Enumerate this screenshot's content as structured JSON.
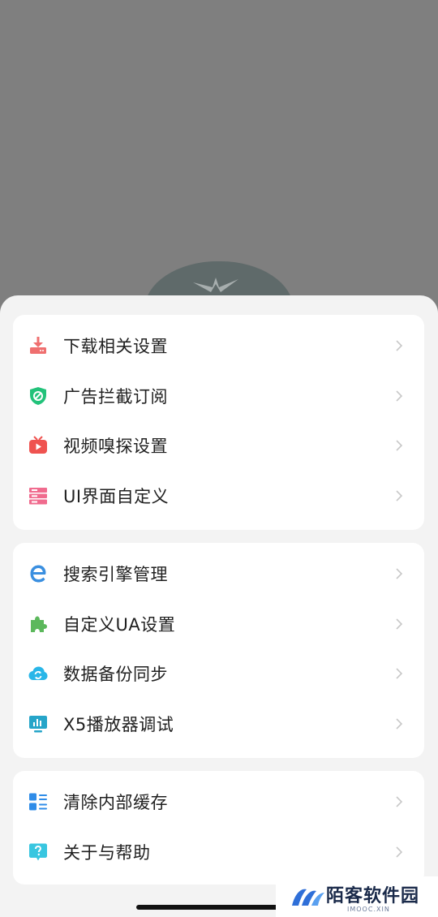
{
  "groups": [
    {
      "items": [
        {
          "label": "下载相关设置",
          "icon": "download-icon",
          "color": "#ef6f6f"
        },
        {
          "label": "广告拦截订阅",
          "icon": "ad-block-shield-icon",
          "color": "#22c27a"
        },
        {
          "label": "视频嗅探设置",
          "icon": "video-tv-icon",
          "color": "#ef5350"
        },
        {
          "label": "UI界面自定义",
          "icon": "ui-layout-icon",
          "color": "#f06b8e"
        }
      ]
    },
    {
      "items": [
        {
          "label": "搜索引擎管理",
          "icon": "search-engine-e-icon",
          "color": "#3a8fe0"
        },
        {
          "label": "自定义UA设置",
          "icon": "puzzle-icon",
          "color": "#5cb85c"
        },
        {
          "label": "数据备份同步",
          "icon": "cloud-sync-icon",
          "color": "#29b6e8"
        },
        {
          "label": "X5播放器调试",
          "icon": "monitor-chart-icon",
          "color": "#26a5c9"
        }
      ]
    },
    {
      "items": [
        {
          "label": "清除内部缓存",
          "icon": "clear-cache-icon",
          "color": "#2f8ce8"
        },
        {
          "label": "关于与帮助",
          "icon": "help-question-icon",
          "color": "#38c6e0"
        }
      ]
    }
  ],
  "watermark": {
    "text": "陌客软件园",
    "sub": "IMOOC.XIN"
  }
}
